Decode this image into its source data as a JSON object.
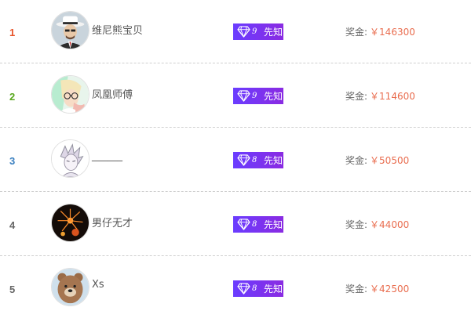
{
  "colors": {
    "rank_1": "#e8552b",
    "rank_2": "#5aa81f",
    "rank_3": "#3a7fc0",
    "rank_other": "#666666",
    "prize_value": "#e96d4f",
    "badge_start": "#6a3cff",
    "badge_end": "#8a2be2"
  },
  "leaderboard": {
    "rows": [
      {
        "rank": "1",
        "username": "维尼熊宝贝",
        "level": "9",
        "badge_label": "先知",
        "prize_label": "奖金:",
        "prize_value": "￥146300",
        "avatar_icon": "man-in-white-hat-avatar"
      },
      {
        "rank": "2",
        "username": "凤凰师傅",
        "level": "9",
        "badge_label": "先知",
        "prize_label": "奖金:",
        "prize_value": "￥114600",
        "avatar_icon": "anime-glasses-avatar"
      },
      {
        "rank": "3",
        "username": "______",
        "level": "8",
        "badge_label": "先知",
        "prize_label": "奖金:",
        "prize_value": "￥50500",
        "avatar_icon": "sketch-character-avatar"
      },
      {
        "rank": "4",
        "username": "男仔无才",
        "level": "8",
        "badge_label": "先知",
        "prize_label": "奖金:",
        "prize_value": "￥44000",
        "avatar_icon": "fireworks-avatar"
      },
      {
        "rank": "5",
        "username": "Xs",
        "level": "8",
        "badge_label": "先知",
        "prize_label": "奖金:",
        "prize_value": "￥42500",
        "avatar_icon": "bear-avatar"
      }
    ]
  }
}
